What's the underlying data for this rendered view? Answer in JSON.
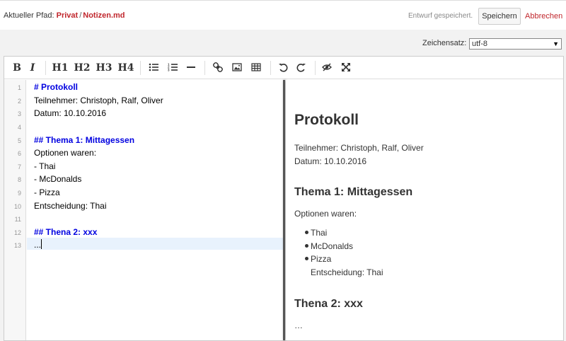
{
  "header": {
    "path_label": "Aktueller Pfad:",
    "path_parts": [
      "Privat",
      "Notizen.md"
    ],
    "path_sep": "/",
    "status": "Entwurf gespeichert.",
    "save_label": "Speichern",
    "cancel_label": "Abbrechen"
  },
  "charset": {
    "label": "Zeichensatz:",
    "value": "utf-8"
  },
  "toolbar": {
    "bold": "B",
    "italic": "I",
    "h1": "H1",
    "h2": "H2",
    "h3": "H3",
    "h4": "H4"
  },
  "editor": {
    "lines": [
      "# Protokoll",
      "Teilnehmer: Christoph, Ralf, Oliver",
      "Datum: 10.10.2016",
      "",
      "## Thema 1: Mittagessen",
      "Optionen waren:",
      "- Thai",
      "- McDonalds",
      "- Pizza",
      "Entscheidung: Thai",
      "",
      "## Thena 2: xxx",
      "..."
    ],
    "line_numbers": [
      "1",
      "2",
      "3",
      "4",
      "5",
      "6",
      "7",
      "8",
      "9",
      "10",
      "11",
      "12",
      "13"
    ]
  },
  "preview": {
    "h1": "Protokoll",
    "para1_line1": "Teilnehmer: Christoph, Ralf, Oliver",
    "para1_line2": "Datum: 10.10.2016",
    "h2a": "Thema 1: Mittagessen",
    "para2": "Optionen waren:",
    "list": [
      "Thai",
      "McDonalds",
      "Pizza"
    ],
    "list_tail": "Entscheidung: Thai",
    "h2b": "Thena 2: xxx",
    "para3": "…"
  },
  "colors": {
    "link": "#c0262c",
    "heading_code": "#0000e0",
    "active_line": "#e8f2fd"
  }
}
